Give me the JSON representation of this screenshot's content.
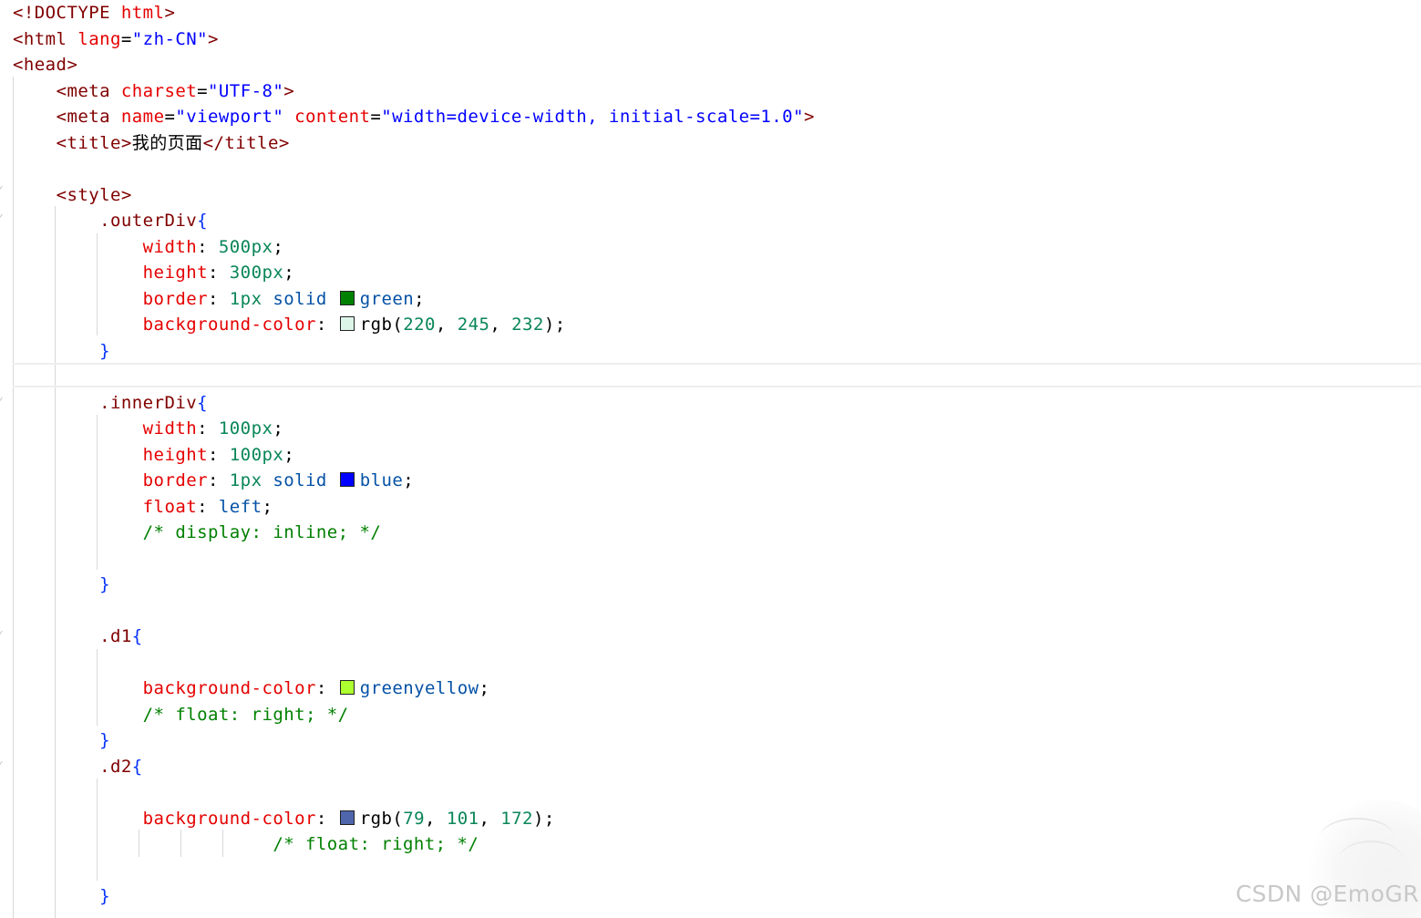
{
  "editor": {
    "colors": {
      "tag": "#800000",
      "attribute": "#e50000",
      "string": "#0000ff",
      "selector": "#800000",
      "brace": "#0431fa",
      "property": "#e50000",
      "number": "#098658",
      "value": "#0451a5",
      "comment": "#008000"
    },
    "lines": [
      [
        {
          "t": "<!DOCTYPE ",
          "c": "tag"
        },
        {
          "t": "html",
          "c": "attr"
        },
        {
          "t": ">",
          "c": "tag"
        }
      ],
      [
        {
          "t": "<html ",
          "c": "tag"
        },
        {
          "t": "lang",
          "c": "attr"
        },
        {
          "t": "=",
          "c": "text"
        },
        {
          "t": "\"zh-CN\"",
          "c": "str"
        },
        {
          "t": ">",
          "c": "tag"
        }
      ],
      [
        {
          "t": "<head>",
          "c": "tag"
        }
      ],
      [
        {
          "t": "    ",
          "c": "text"
        },
        {
          "t": "<meta ",
          "c": "tag"
        },
        {
          "t": "charset",
          "c": "attr"
        },
        {
          "t": "=",
          "c": "text"
        },
        {
          "t": "\"UTF-8\"",
          "c": "str"
        },
        {
          "t": ">",
          "c": "tag"
        }
      ],
      [
        {
          "t": "    ",
          "c": "text"
        },
        {
          "t": "<meta ",
          "c": "tag"
        },
        {
          "t": "name",
          "c": "attr"
        },
        {
          "t": "=",
          "c": "text"
        },
        {
          "t": "\"viewport\" ",
          "c": "str"
        },
        {
          "t": "content",
          "c": "attr"
        },
        {
          "t": "=",
          "c": "text"
        },
        {
          "t": "\"width=device-width, initial-scale=1.0\"",
          "c": "str"
        },
        {
          "t": ">",
          "c": "tag"
        }
      ],
      [
        {
          "t": "    ",
          "c": "text"
        },
        {
          "t": "<title>",
          "c": "tag"
        },
        {
          "t": "我的页面",
          "c": "text"
        },
        {
          "t": "</title>",
          "c": "tag"
        }
      ],
      [],
      [
        {
          "t": "    ",
          "c": "text"
        },
        {
          "t": "<style>",
          "c": "tag"
        }
      ],
      [
        {
          "t": "        ",
          "c": "text"
        },
        {
          "t": ".outerDiv",
          "c": "sel"
        },
        {
          "t": "{",
          "c": "brace"
        }
      ],
      [
        {
          "t": "            ",
          "c": "text"
        },
        {
          "t": "width",
          "c": "prop"
        },
        {
          "t": ": ",
          "c": "punc"
        },
        {
          "t": "500px",
          "c": "num"
        },
        {
          "t": ";",
          "c": "punc"
        }
      ],
      [
        {
          "t": "            ",
          "c": "text"
        },
        {
          "t": "height",
          "c": "prop"
        },
        {
          "t": ": ",
          "c": "punc"
        },
        {
          "t": "300px",
          "c": "num"
        },
        {
          "t": ";",
          "c": "punc"
        }
      ],
      [
        {
          "t": "            ",
          "c": "text"
        },
        {
          "t": "border",
          "c": "prop"
        },
        {
          "t": ": ",
          "c": "punc"
        },
        {
          "t": "1px ",
          "c": "num"
        },
        {
          "t": "solid ",
          "c": "val"
        },
        {
          "sw": "#008000"
        },
        {
          "t": "green",
          "c": "val"
        },
        {
          "t": ";",
          "c": "punc"
        }
      ],
      [
        {
          "t": "            ",
          "c": "text"
        },
        {
          "t": "background-color",
          "c": "prop"
        },
        {
          "t": ": ",
          "c": "punc"
        },
        {
          "sw": "rgb(220, 245, 232)"
        },
        {
          "t": "rgb(",
          "c": "text"
        },
        {
          "t": "220",
          "c": "num"
        },
        {
          "t": ", ",
          "c": "punc"
        },
        {
          "t": "245",
          "c": "num"
        },
        {
          "t": ", ",
          "c": "punc"
        },
        {
          "t": "232",
          "c": "num"
        },
        {
          "t": ");",
          "c": "punc"
        }
      ],
      [
        {
          "t": "        ",
          "c": "text"
        },
        {
          "t": "}",
          "c": "brace"
        }
      ],
      [],
      [
        {
          "t": "        ",
          "c": "text"
        },
        {
          "t": ".innerDiv",
          "c": "sel"
        },
        {
          "t": "{",
          "c": "brace"
        }
      ],
      [
        {
          "t": "            ",
          "c": "text"
        },
        {
          "t": "width",
          "c": "prop"
        },
        {
          "t": ": ",
          "c": "punc"
        },
        {
          "t": "100px",
          "c": "num"
        },
        {
          "t": ";",
          "c": "punc"
        }
      ],
      [
        {
          "t": "            ",
          "c": "text"
        },
        {
          "t": "height",
          "c": "prop"
        },
        {
          "t": ": ",
          "c": "punc"
        },
        {
          "t": "100px",
          "c": "num"
        },
        {
          "t": ";",
          "c": "punc"
        }
      ],
      [
        {
          "t": "            ",
          "c": "text"
        },
        {
          "t": "border",
          "c": "prop"
        },
        {
          "t": ": ",
          "c": "punc"
        },
        {
          "t": "1px ",
          "c": "num"
        },
        {
          "t": "solid ",
          "c": "val"
        },
        {
          "sw": "#0000ff"
        },
        {
          "t": "blue",
          "c": "val"
        },
        {
          "t": ";",
          "c": "punc"
        }
      ],
      [
        {
          "t": "            ",
          "c": "text"
        },
        {
          "t": "float",
          "c": "prop"
        },
        {
          "t": ": ",
          "c": "punc"
        },
        {
          "t": "left",
          "c": "val"
        },
        {
          "t": ";",
          "c": "punc"
        }
      ],
      [
        {
          "t": "            ",
          "c": "text"
        },
        {
          "t": "/* display: inline; */",
          "c": "com"
        }
      ],
      [],
      [
        {
          "t": "        ",
          "c": "text"
        },
        {
          "t": "}",
          "c": "brace"
        }
      ],
      [],
      [
        {
          "t": "        ",
          "c": "text"
        },
        {
          "t": ".d1",
          "c": "sel"
        },
        {
          "t": "{",
          "c": "brace"
        }
      ],
      [],
      [
        {
          "t": "            ",
          "c": "text"
        },
        {
          "t": "background-color",
          "c": "prop"
        },
        {
          "t": ": ",
          "c": "punc"
        },
        {
          "sw": "#adff2f"
        },
        {
          "t": "greenyellow",
          "c": "val"
        },
        {
          "t": ";",
          "c": "punc"
        }
      ],
      [
        {
          "t": "            ",
          "c": "text"
        },
        {
          "t": "/* float: right; */",
          "c": "com"
        }
      ],
      [
        {
          "t": "        ",
          "c": "text"
        },
        {
          "t": "}",
          "c": "brace"
        }
      ],
      [
        {
          "t": "        ",
          "c": "text"
        },
        {
          "t": ".d2",
          "c": "sel"
        },
        {
          "t": "{",
          "c": "brace"
        }
      ],
      [],
      [
        {
          "t": "            ",
          "c": "text"
        },
        {
          "t": "background-color",
          "c": "prop"
        },
        {
          "t": ": ",
          "c": "punc"
        },
        {
          "sw": "rgb(79, 101, 172)"
        },
        {
          "t": "rgb(",
          "c": "text"
        },
        {
          "t": "79",
          "c": "num"
        },
        {
          "t": ", ",
          "c": "punc"
        },
        {
          "t": "101",
          "c": "num"
        },
        {
          "t": ", ",
          "c": "punc"
        },
        {
          "t": "172",
          "c": "num"
        },
        {
          "t": ");",
          "c": "punc"
        }
      ],
      [
        {
          "t": "                        ",
          "c": "text"
        },
        {
          "t": "/* float: right; */",
          "c": "com"
        }
      ],
      [],
      [
        {
          "t": "        ",
          "c": "text"
        },
        {
          "t": "}",
          "c": "brace"
        }
      ]
    ]
  },
  "watermark": {
    "text": "CSDN @EmoGR"
  }
}
